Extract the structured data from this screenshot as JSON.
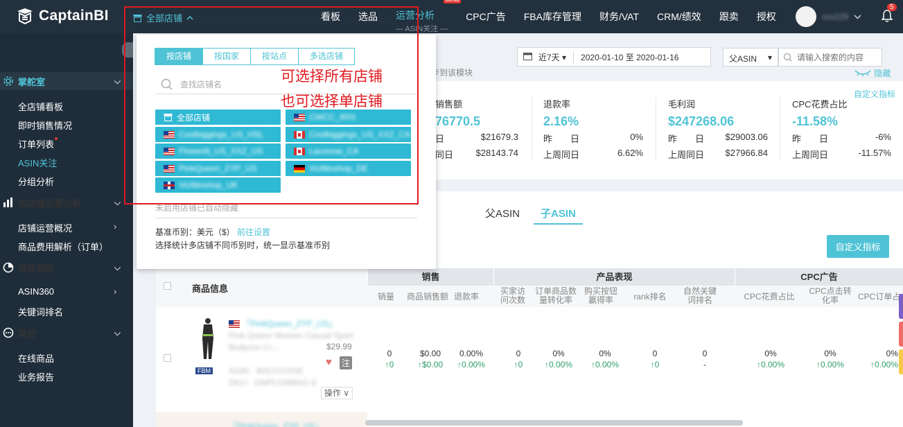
{
  "app": {
    "name": "CaptainBI"
  },
  "header": {
    "store_switch_label": "全部店铺",
    "nav": [
      {
        "label": "看板"
      },
      {
        "label": "选品"
      },
      {
        "label": "运营分析",
        "sub": "— ASIN关注 —",
        "badge": "beta"
      },
      {
        "label": "CPC广告"
      },
      {
        "label": "FBA库存管理"
      },
      {
        "label": "财务/VAT"
      },
      {
        "label": "CRM/绩效"
      },
      {
        "label": "跟卖"
      },
      {
        "label": "授权"
      }
    ],
    "user_name": "xxx229",
    "notification_count": "5"
  },
  "sidebar": {
    "groups": [
      {
        "label": "掌舵室",
        "icon": "gear-icon",
        "items": [
          "全店铺看板",
          "即时销售情况",
          "订单列表",
          "ASIN关注",
          "分组分析"
        ]
      },
      {
        "label": "单店铺运营分析",
        "icon": "bar-chart-icon",
        "items": [
          "店铺运营概况",
          "商品费用解析（订单）"
        ]
      },
      {
        "label": "商品洞悉",
        "icon": "pie-chart-icon",
        "items": [
          "ASIN360",
          "关键词排名"
        ]
      },
      {
        "label": "其他",
        "icon": "more-icon",
        "items": [
          "在线商品",
          "业务报告"
        ]
      }
    ],
    "active_item": "ASIN关注"
  },
  "filters": {
    "date_range_type": "近7天",
    "date_range": "2020-01-10 至 2020-01-16",
    "asin_type": "父ASIN",
    "search_placeholder": "请输入搜索的内容",
    "sync_note": "步到该模块",
    "hide_label": "隐藏",
    "custom_metric_label": "自定义指标"
  },
  "kpis": [
    {
      "title": "销售额",
      "value": "76770.5",
      "rows": [
        [
          "日",
          "$21679.3"
        ],
        [
          "同日",
          "$28143.74"
        ]
      ]
    },
    {
      "title": "退款率",
      "value": "2.16%",
      "rows": [
        [
          "昨　　日",
          "0%"
        ],
        [
          "上周同日",
          "6.62%"
        ]
      ]
    },
    {
      "title": "毛利润",
      "value": "$247268.06",
      "rows": [
        [
          "昨　　日",
          "$29003.06"
        ],
        [
          "上周同日",
          "$27966.84"
        ]
      ]
    },
    {
      "title": "CPC花费占比",
      "value": "-11.58%",
      "rows": [
        [
          "昨　　日",
          "-6%"
        ],
        [
          "上周同日",
          "-11.57%"
        ]
      ]
    }
  ],
  "asin_tabs": [
    "父ASIN",
    "子ASIN"
  ],
  "custom_button_label": "自定义指标",
  "table": {
    "product_header": "商品信息",
    "groups": [
      "销售",
      "产品表现",
      "CPC广告"
    ],
    "columns": [
      "销量",
      "商品销售额",
      "退款率",
      "买家访问次数",
      "订单商品数量转化率",
      "购买按钮赢得率",
      "rank排名",
      "自然关键词排名",
      "CPC花费占比",
      "CPC点击转化率",
      "CPC订单占"
    ],
    "row": {
      "store": "「PinkQueen_ZYP_US」",
      "title": "Pink Queen Women Casual Sport Bodycon Cr...",
      "price": "$29.99",
      "asin": "ASIN：B01XXXX0E",
      "sku": "SKU：GMPL0398AG-S",
      "fulfillment": "FBM",
      "note_label": "注",
      "ops_label": "操作",
      "values": [
        "0",
        "$0.00",
        "0.00%",
        "0",
        "0%",
        "0%",
        "0",
        "0",
        "0%",
        "0%",
        "0%"
      ],
      "changes": [
        "↑0",
        "↑$0.00",
        "↑0.00%",
        "↑0",
        "↑0.00%",
        "↑0.00%",
        "↑0",
        "-",
        "↑0.00%",
        "↑0.00%",
        "↑0.00%"
      ]
    },
    "next_row_store": "「PinkQueen_ZYP_US」"
  },
  "store_dropdown": {
    "tabs": [
      "按店铺",
      "按国家",
      "按站点",
      "多选店铺"
    ],
    "search_placeholder": "查找店铺名",
    "stores": [
      {
        "label": "全部店铺",
        "icon": "store-icon"
      },
      {
        "label": "CWCC_IRIS",
        "flag": "us"
      },
      {
        "label": "Coolbiggings_US_HSL",
        "flag": "us"
      },
      {
        "label": "Coolbiggings_US_XXZ_CA",
        "flag": "ca"
      },
      {
        "label": "Flowerlit_US_XXZ_US",
        "flag": "us"
      },
      {
        "label": "Laconow_CA",
        "flag": "ca"
      },
      {
        "label": "PinkQueen_ZYP_US",
        "flag": "us"
      },
      {
        "label": "Vicfittoshop_DE",
        "flag": "de"
      },
      {
        "label": "Vicfittoshop_UK",
        "flag": "uk"
      }
    ],
    "hidden_note": "未启用店铺已自动隐藏",
    "currency_label": "基准币别：美元（$）",
    "currency_link": "前往设置",
    "currency_note": "选择统计多店铺不同币别时，统一显示基准币别"
  },
  "annotation": {
    "line1": "可选择所有店铺",
    "line2": "也可选择单店铺",
    "color": "#e0191f"
  }
}
